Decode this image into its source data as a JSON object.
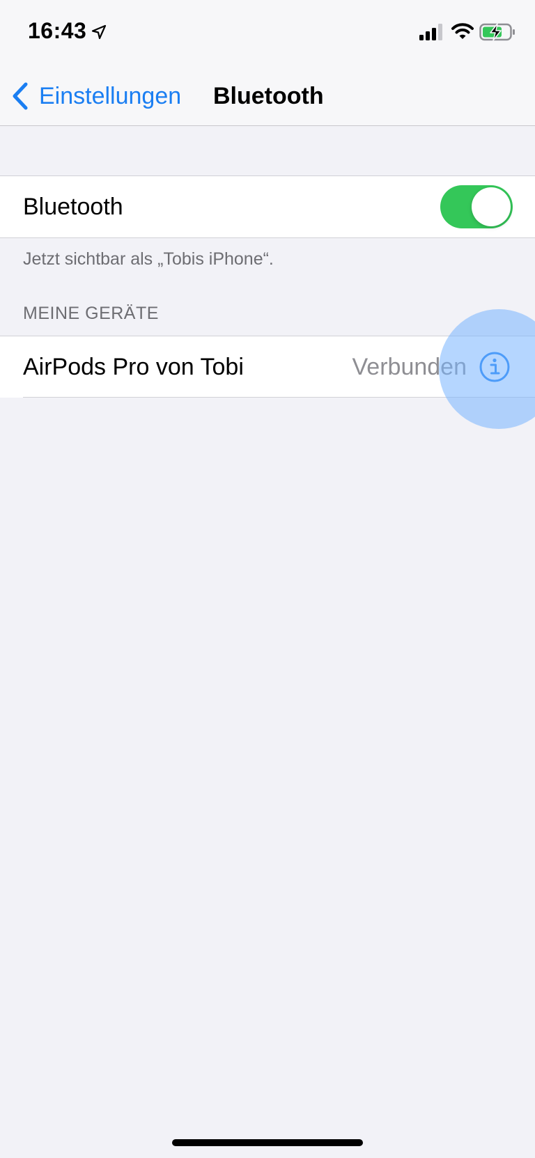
{
  "status_bar": {
    "time": "16:43",
    "icons": [
      "location-arrow-icon",
      "cellular-signal-icon",
      "wifi-icon",
      "battery-charging-icon"
    ]
  },
  "nav": {
    "back_label": "Einstellungen",
    "title": "Bluetooth",
    "back_icon": "chevron-left-icon"
  },
  "bluetooth": {
    "label": "Bluetooth",
    "enabled": true,
    "visible_as": "Jetzt sichtbar als „Tobis iPhone“."
  },
  "devices": {
    "header": "MEINE GERÄTE",
    "items": [
      {
        "name": "AirPods Pro von Tobi",
        "status": "Verbunden",
        "icon": "info-icon"
      }
    ]
  },
  "colors": {
    "accent": "#1a7ef2",
    "toggle_on": "#34c759",
    "background": "#f2f2f7",
    "secondary_text": "#8e8e93"
  }
}
